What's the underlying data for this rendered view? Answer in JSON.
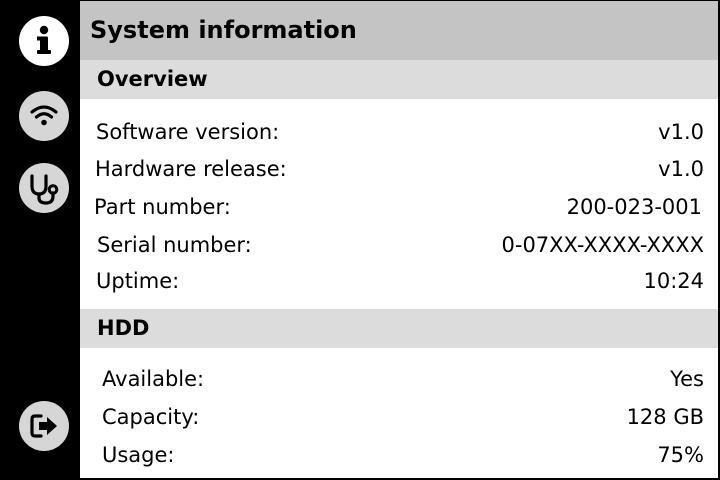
{
  "sidebar": {
    "items": [
      {
        "icon": "info-icon",
        "active": true
      },
      {
        "icon": "wifi-icon",
        "active": false
      },
      {
        "icon": "stethoscope-icon",
        "active": false
      }
    ],
    "exit": {
      "icon": "logout-icon"
    }
  },
  "header": {
    "title": "System information"
  },
  "overview": {
    "title": "Overview",
    "rows": [
      {
        "label": "Software version:",
        "value": "v1.0"
      },
      {
        "label": "Hardware release:",
        "value": "v1.0"
      },
      {
        "label": "Part number:",
        "value": "200-023-001"
      },
      {
        "label": "Serial number:",
        "value": "0-07XX-XXXX-XXXX"
      },
      {
        "label": "Uptime:",
        "value": "10:24"
      }
    ]
  },
  "hdd": {
    "title": "HDD",
    "rows": [
      {
        "label": "Available:",
        "value": "Yes"
      },
      {
        "label": "Capacity:",
        "value": "128 GB"
      },
      {
        "label": "Usage:",
        "value": "75%"
      }
    ]
  },
  "colors": {
    "sidebar": "#000000",
    "title_bar": "#c4c4c4",
    "section_bar": "#dcdcdc",
    "active_button": "#ffffff",
    "inactive_button": "#d6d6d6"
  }
}
